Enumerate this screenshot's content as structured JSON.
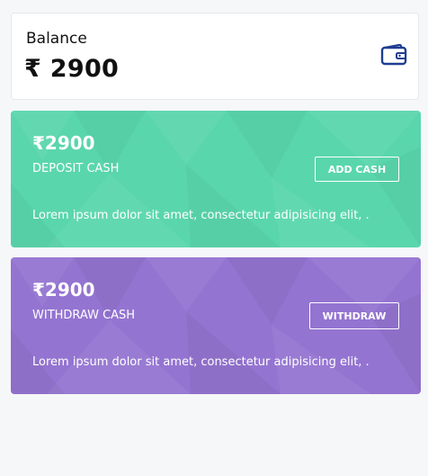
{
  "balance": {
    "title": "Balance",
    "amount": "₹ 2900"
  },
  "deposit": {
    "amount": "₹2900",
    "label": "DEPOSIT CASH",
    "button_label": "ADD CASH",
    "description": "Lorem ipsum dolor sit amet, consectetur adipisicing elit, .",
    "color": "#5ad6ac"
  },
  "withdraw": {
    "amount": "₹2900",
    "label": "WITHDRAW CASH",
    "button_label": "WITHDRAW",
    "description": "Lorem ipsum dolor sit amet, consectetur adipisicing elit, .",
    "color": "#9474d1"
  },
  "colors": {
    "wallet_icon": "#1f3e91",
    "page_background": "#f6f7f9"
  },
  "icons": {
    "balance": "wallet-icon"
  }
}
